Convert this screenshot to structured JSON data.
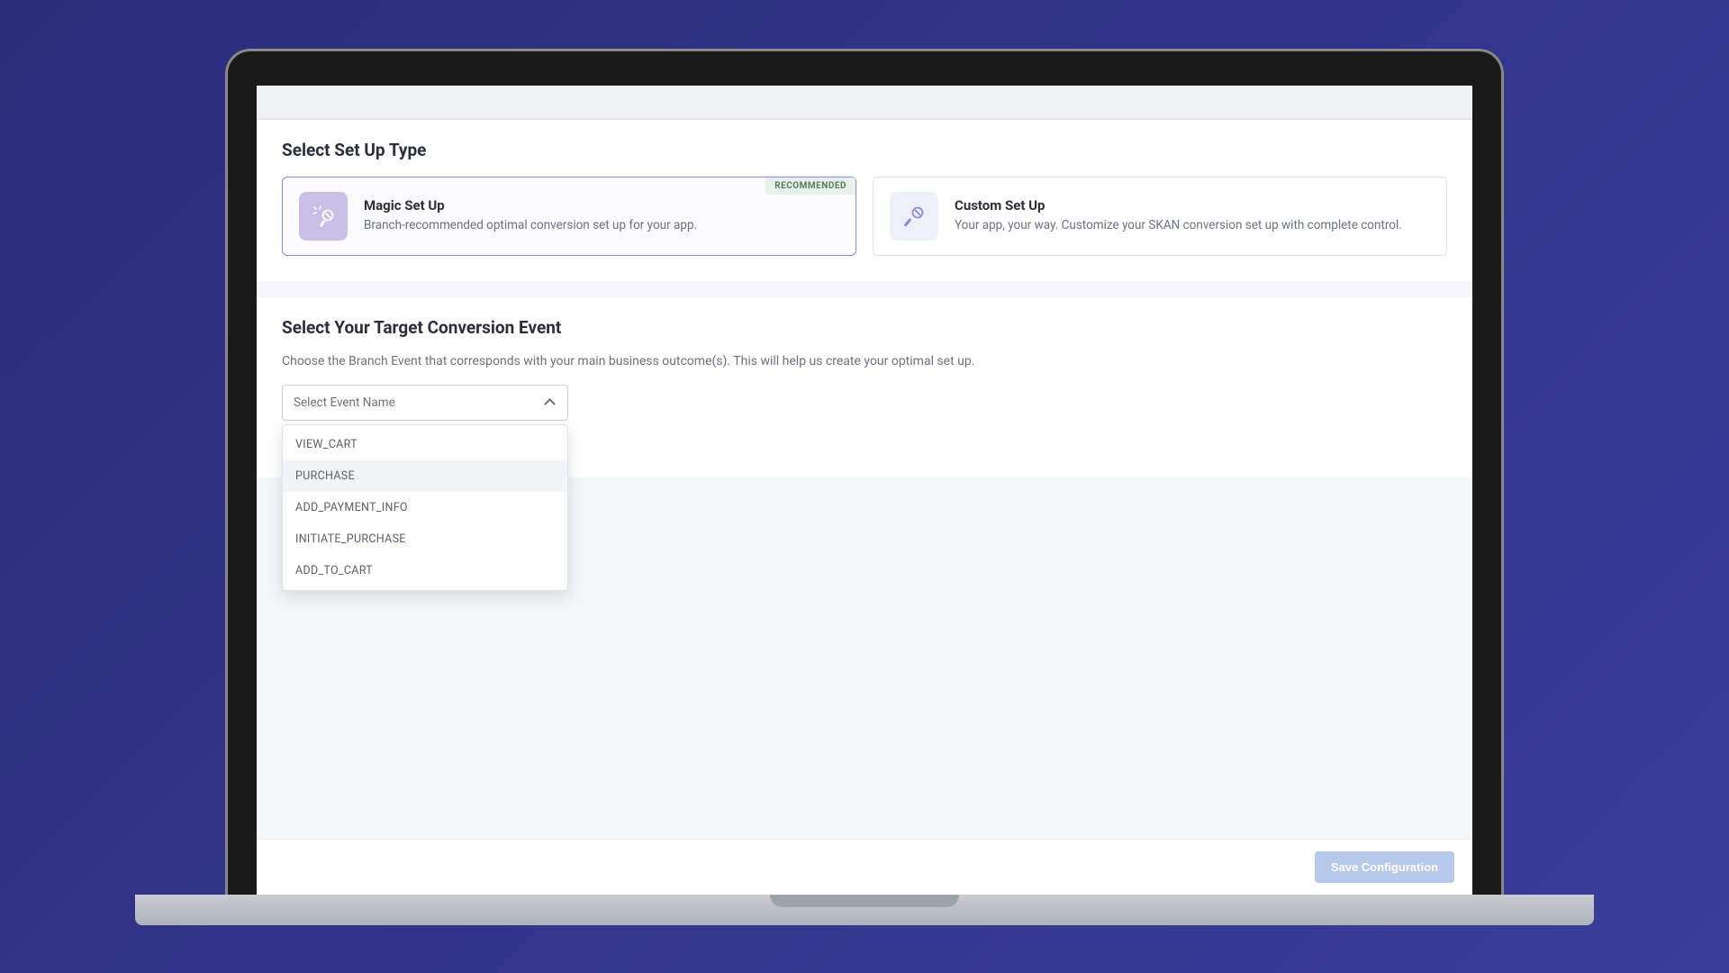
{
  "section1": {
    "title": "Select Set Up Type",
    "magic": {
      "badge": "RECOMMENDED",
      "title": "Magic Set Up",
      "desc": "Branch-recommended optimal conversion set up for your app."
    },
    "custom": {
      "title": "Custom Set Up",
      "desc": "Your app, your way. Customize your SKAN conversion set up with complete control."
    }
  },
  "section2": {
    "title": "Select Your Target Conversion Event",
    "sub": "Choose the Branch Event that corresponds with your main business outcome(s). This will help us create your optimal set up.",
    "placeholder": "Select Event Name",
    "options": {
      "0": "VIEW_CART",
      "1": "PURCHASE",
      "2": "ADD_PAYMENT_INFO",
      "3": "INITIATE_PURCHASE",
      "4": "ADD_TO_CART"
    }
  },
  "footer": {
    "save": "Save Configuration"
  }
}
